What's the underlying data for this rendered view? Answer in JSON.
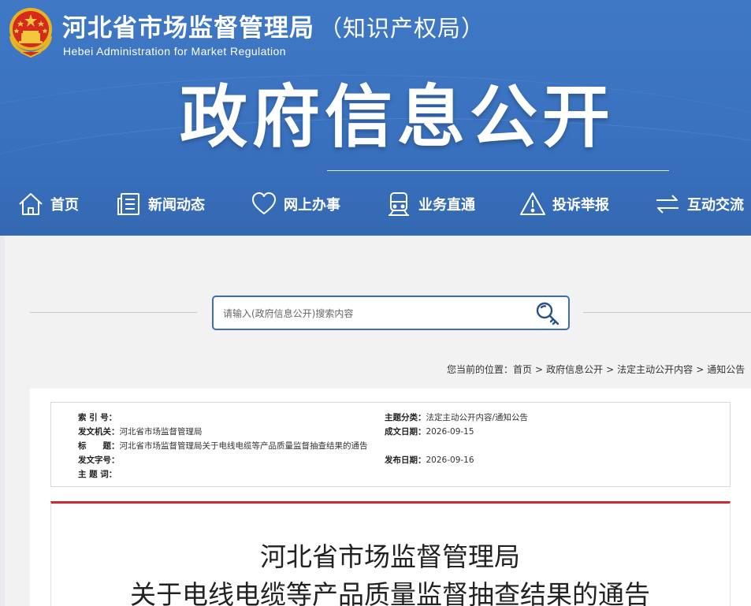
{
  "header": {
    "org_name_cn": "河北省市场监督管理局",
    "org_name_sub": "（知识产权局）",
    "org_name_en": "Hebei Administration for Market Regulation",
    "site_title": "政府信息公开"
  },
  "nav": {
    "items": [
      {
        "label": "首页",
        "icon": "home-icon"
      },
      {
        "label": "新闻动态",
        "icon": "news-icon"
      },
      {
        "label": "网上办事",
        "icon": "heart-icon"
      },
      {
        "label": "业务直通",
        "icon": "train-icon"
      },
      {
        "label": "投诉举报",
        "icon": "warning-icon"
      },
      {
        "label": "互动交流",
        "icon": "exchange-icon"
      }
    ]
  },
  "search": {
    "placeholder": "请输入(政府信息公开)搜索内容",
    "value": ""
  },
  "breadcrumb": {
    "prefix": "您当前的位置：",
    "items": [
      "首页",
      "政府信息公开",
      "法定主动公开内容",
      "通知公告"
    ],
    "separator": ">"
  },
  "meta": {
    "index_label": "索 引 号：",
    "index_value": "",
    "category_label": "主题分类：",
    "category_value": "法定主动公开内容/通知公告",
    "issuer_label": "发文机关：",
    "issuer_value": "河北省市场监督管理局",
    "written_date_label": "成文日期：",
    "written_date_value": "2026-09-15",
    "title_label": "标　　题：",
    "title_value": "河北省市场监督管理局关于电线电缆等产品质量监督抽查结果的通告",
    "doc_number_label": "发文字号：",
    "doc_number_value": "",
    "publish_date_label": "发布日期：",
    "publish_date_value": "2026-09-16",
    "keywords_label": "主 题 词：",
    "keywords_value": ""
  },
  "document": {
    "title_line1": "河北省市场监督管理局",
    "title_line2": "关于电线电缆等产品质量监督抽查结果的通告"
  },
  "colors": {
    "header_blue": "#3a72c0",
    "search_border": "#3a6fb8",
    "accent_red": "#d2292f"
  }
}
